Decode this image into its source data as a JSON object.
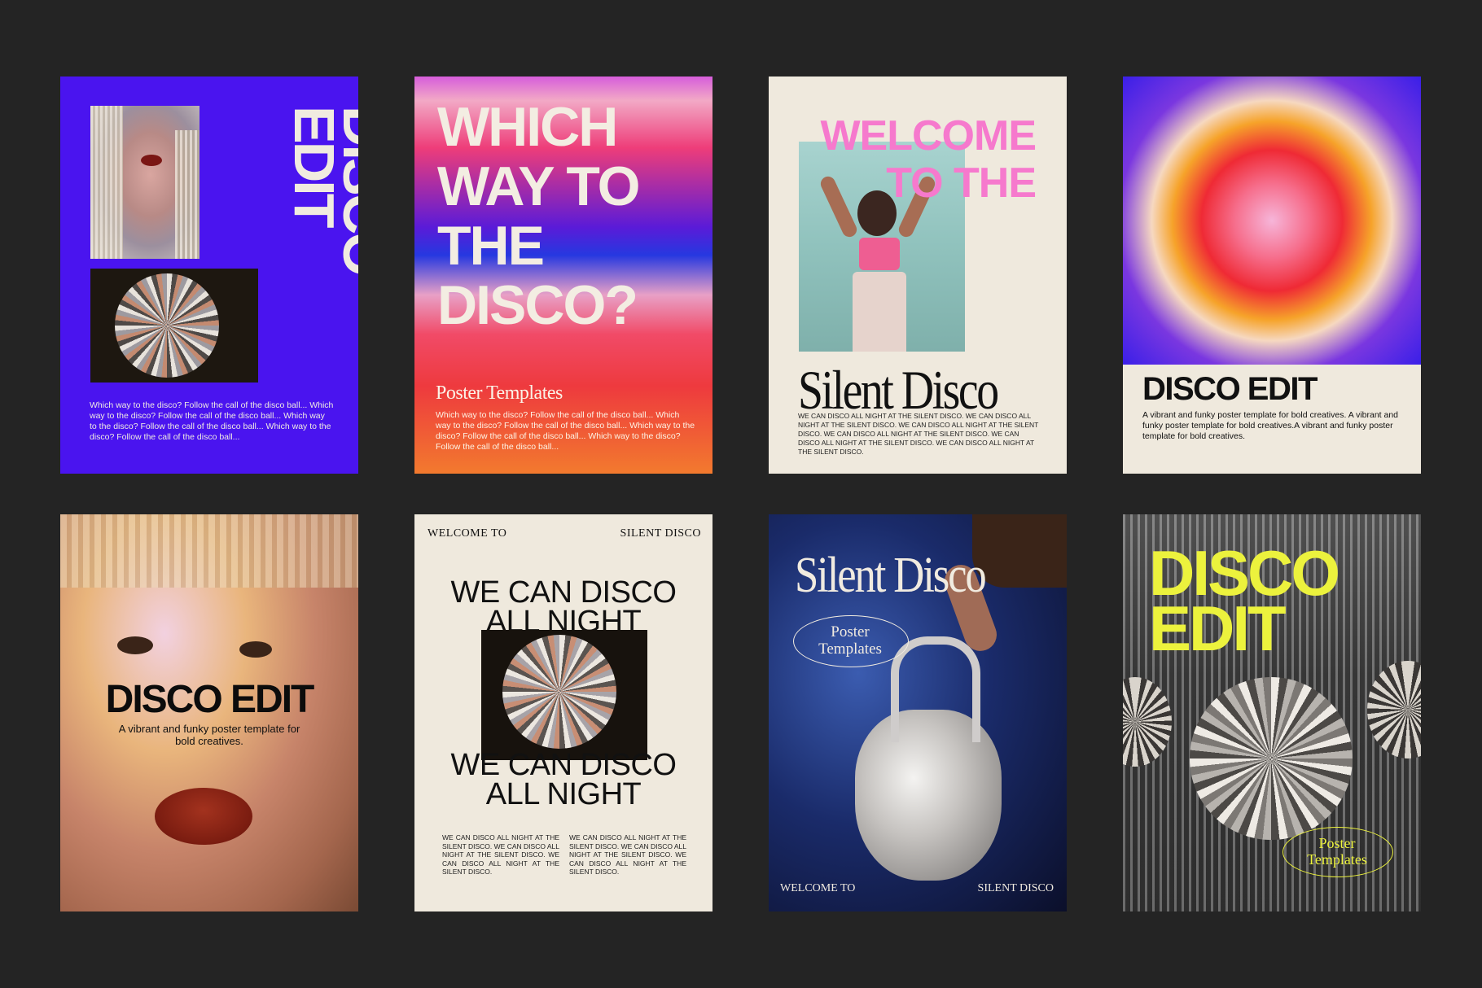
{
  "posters": {
    "p1": {
      "title_line1": "DISCO",
      "title_line2": "EDIT",
      "body": "Which way to the disco? Follow the call of the disco ball... Which way to the disco? Follow the call of the disco ball... Which way to the disco? Follow the call of the disco ball... Which way to the disco? Follow the call of the disco ball..."
    },
    "p2": {
      "headline": [
        "WHICH",
        "WAY TO",
        "THE",
        "DISCO?"
      ],
      "subtitle": "Poster Templates",
      "body": "Which way to the disco? Follow the call of the disco ball... Which way to the disco? Follow the call of the disco ball... Which way to the disco? Follow the call of the disco ball... Which way to the disco? Follow the call of the disco ball..."
    },
    "p3": {
      "headline": [
        "WELCOME",
        "TO THE"
      ],
      "title": "Silent Disco",
      "body": "WE CAN DISCO ALL NIGHT AT THE SILENT DISCO. WE CAN DISCO ALL NIGHT AT THE SILENT DISCO. WE CAN DISCO ALL NIGHT AT THE SILENT DISCO. WE CAN DISCO ALL NIGHT AT THE SILENT DISCO. WE CAN DISCO ALL NIGHT AT THE SILENT DISCO. WE CAN DISCO ALL NIGHT AT THE SILENT DISCO."
    },
    "p4": {
      "title": "DISCO EDIT",
      "body": "A vibrant and funky poster template for bold creatives. A vibrant and funky poster template for bold creatives.A vibrant and funky poster template for bold creatives."
    },
    "p5": {
      "title": "DISCO EDIT",
      "body": "A vibrant and funky poster template for bold creatives."
    },
    "p6": {
      "tag_left": "WELCOME TO",
      "tag_right": "SILENT DISCO",
      "headline_top": [
        "WE CAN DISCO",
        "ALL NIGHT"
      ],
      "headline_bottom": [
        "WE CAN DISCO",
        "ALL NIGHT"
      ],
      "col_left": "WE CAN DISCO ALL NIGHT AT THE SILENT DISCO. WE CAN DISCO ALL NIGHT AT THE SILENT DISCO. WE CAN DISCO ALL NIGHT AT THE SILENT DISCO.",
      "col_right": "WE CAN DISCO ALL NIGHT AT THE SILENT DISCO. WE CAN DISCO ALL NIGHT AT THE SILENT DISCO. WE CAN DISCO ALL NIGHT AT THE SILENT DISCO."
    },
    "p7": {
      "title": "Silent Disco",
      "oval_line1": "Poster",
      "oval_line2": "Templates",
      "tag_left": "WELCOME TO",
      "tag_right": "SILENT DISCO"
    },
    "p8": {
      "title_line1": "DISCO",
      "title_line2": "EDIT",
      "oval_line1": "Poster",
      "oval_line2": "Templates"
    }
  },
  "colors": {
    "background": "#242424",
    "p1_bg": "#4a14ef",
    "cream": "#efe9dd",
    "pink": "#f679cd",
    "yellow": "#ecf23d"
  }
}
